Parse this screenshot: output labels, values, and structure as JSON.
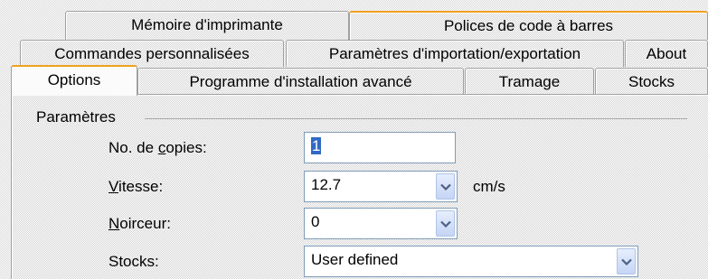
{
  "tabs": {
    "row1": [
      {
        "label": "Mémoire d'imprimante"
      },
      {
        "label": "Polices de code à barres"
      }
    ],
    "row2": [
      {
        "label": "Commandes personnalisées"
      },
      {
        "label": "Paramètres d'importation/exportation"
      },
      {
        "label": "About"
      }
    ],
    "row3": [
      {
        "label": "Options"
      },
      {
        "label": "Programme d'installation avancé"
      },
      {
        "label": "Tramage"
      },
      {
        "label": "Stocks"
      }
    ]
  },
  "group": {
    "title": "Paramètres"
  },
  "fields": {
    "copies": {
      "label_pre": "No. de ",
      "label_u": "c",
      "label_post": "opies:",
      "value": "1"
    },
    "speed": {
      "label_pre": "",
      "label_u": "V",
      "label_post": "itesse:",
      "value": "12.7",
      "unit": "cm/s"
    },
    "darkness": {
      "label_pre": "",
      "label_u": "N",
      "label_post": "oirceur:",
      "value": "0"
    },
    "stocks": {
      "label": "Stocks:",
      "value": "User defined"
    }
  },
  "colors": {
    "selected_tab_accent": "#f0a020",
    "dropdown_arrow": "#4d6185",
    "field_border": "#7f9db9"
  },
  "icons": [
    "chevron-down-icon"
  ]
}
